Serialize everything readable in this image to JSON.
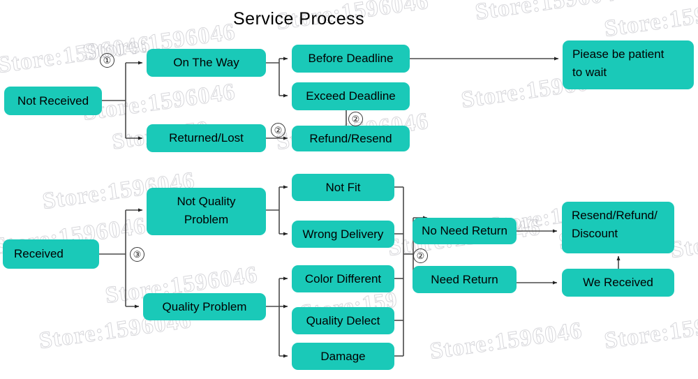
{
  "title": "Service Process",
  "colors": {
    "node_fill": "#1ac9b8",
    "text": "#000000",
    "connector": "#3a3a3a",
    "background": "#ffffff"
  },
  "watermark": {
    "text": "Store:1596046",
    "short_text": "Store:159",
    "tiny_text": "Stor"
  },
  "markers": {
    "one": "①",
    "two": "②",
    "three": "③"
  },
  "nodes": {
    "not_received": "Not Received",
    "on_the_way": "On The Way",
    "returned_lost": "Returned/Lost",
    "before_deadline": "Before Deadline",
    "exceed_deadline": "Exceed Deadline",
    "refund_resend": "Refund/Resend",
    "please_wait_line1": "Piease be patient",
    "please_wait_line2": "to wait",
    "received": "Received",
    "not_quality_problem_line1": "Not Quality",
    "not_quality_problem_line2": "Problem",
    "quality_problem": "Quality Problem",
    "not_fit": "Not Fit",
    "wrong_delivery": "Wrong Delivery",
    "color_different": "Color Different",
    "quality_delect": "Quality Delect",
    "damage": "Damage",
    "no_need_return": "No Need Return",
    "need_return": "Need Return",
    "resend_refund_line1": "Resend/Refund/",
    "resend_refund_line2": "Discount",
    "we_received": "We Received"
  }
}
